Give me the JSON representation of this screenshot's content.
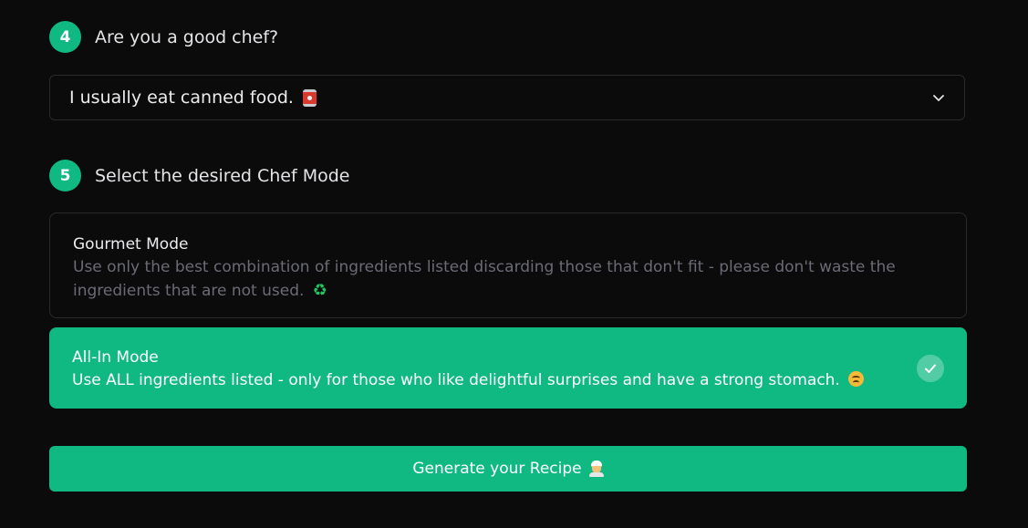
{
  "step4": {
    "number": "4",
    "title": "Are you a good chef?"
  },
  "skill_select": {
    "value": "I usually eat canned food.",
    "value_icon": "canned-food-icon"
  },
  "step5": {
    "number": "5",
    "title": "Select the desired Chef Mode"
  },
  "modes": [
    {
      "title": "Gourmet Mode",
      "description": "Use only the best combination of ingredients listed discarding those that don't fit - please don't waste the ingredients that are not used.",
      "icon": "recycle-icon",
      "selected": false
    },
    {
      "title": "All-In Mode",
      "description": "Use ALL ingredients listed - only for those who like delightful surprises and have a strong stomach.",
      "icon": "upside-down-face-icon",
      "selected": true
    }
  ],
  "generate_button": {
    "label": "Generate your Recipe",
    "icon": "chef-icon"
  },
  "colors": {
    "accent": "#10b981",
    "background": "#0b0b0c",
    "border": "#2a2a2e",
    "muted_text": "#6b6b75"
  }
}
